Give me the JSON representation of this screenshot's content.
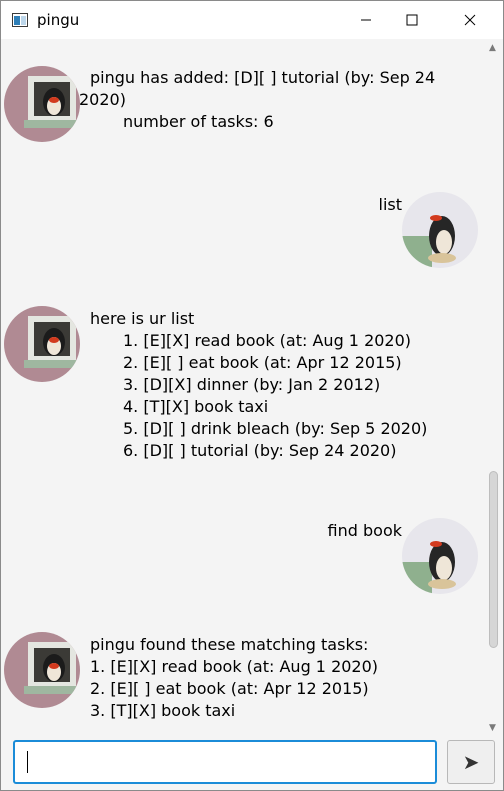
{
  "window": {
    "title": "pingu",
    "icon": "app-window-icon"
  },
  "conversation": [
    {
      "from": "bot",
      "lines": [
        "pingu has added: [D][ ] tutorial (by: Sep 24",
        "2020)",
        "number of tasks: 6"
      ]
    },
    {
      "from": "user",
      "text": "list"
    },
    {
      "from": "bot",
      "lines": [
        "here is ur list",
        "1. [E][X] read book (at: Aug 1 2020)",
        "2. [E][ ] eat book (at: Apr 12 2015)",
        "3. [D][X] dinner (by: Jan 2 2012)",
        "4. [T][X] book taxi",
        "5. [D][ ] drink bleach (by: Sep 5 2020)",
        "6. [D][ ] tutorial (by: Sep 24 2020)"
      ]
    },
    {
      "from": "user",
      "text": "find book"
    },
    {
      "from": "bot",
      "lines": [
        "pingu found these matching tasks:",
        "1. [E][X] read book (at: Aug 1 2020)",
        "2. [E][ ] eat book (at: Apr 12 2015)",
        "3. [T][X] book taxi"
      ]
    }
  ],
  "input": {
    "value": "",
    "placeholder": ""
  },
  "send_button": {
    "icon": "send-arrow-icon",
    "glyph": "➤"
  },
  "colors": {
    "accent": "#1b8cd8",
    "chat_bg": "#f4f4f4"
  }
}
